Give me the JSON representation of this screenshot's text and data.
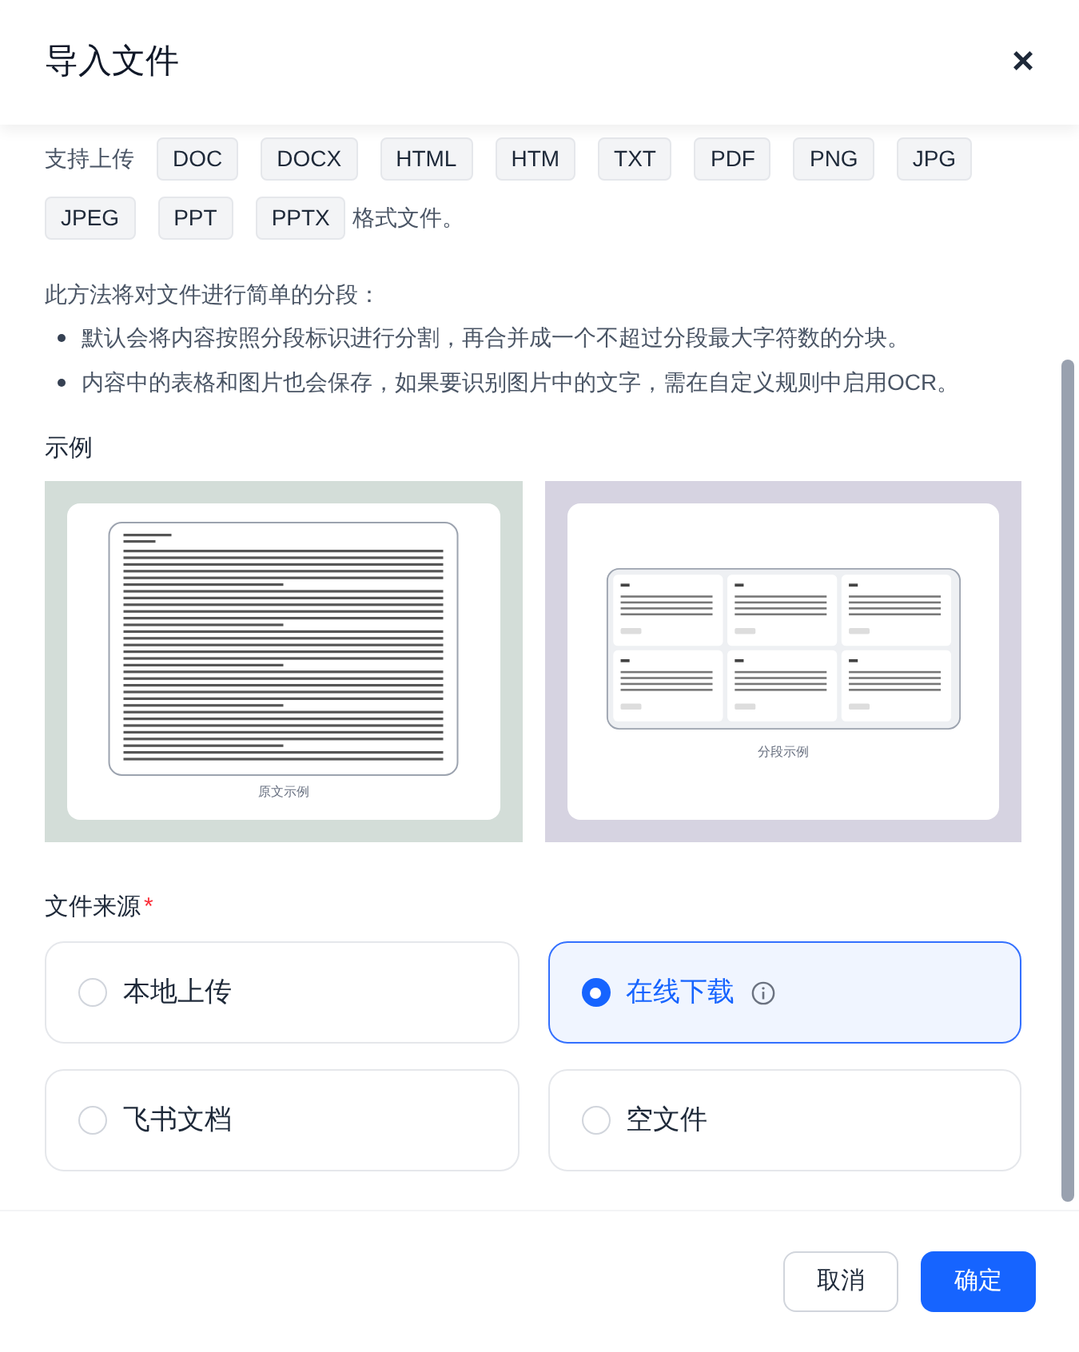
{
  "dialog": {
    "title": "导入文件",
    "close": "×"
  },
  "formats": {
    "prefix": "支持上传",
    "tags": [
      "DOC",
      "DOCX",
      "HTML",
      "HTM",
      "TXT",
      "PDF",
      "PNG",
      "JPG",
      "JPEG",
      "PPT",
      "PPTX"
    ],
    "suffix": "格式文件。"
  },
  "description": {
    "intro": "此方法将对文件进行简单的分段：",
    "bullets": [
      "默认会将内容按照分段标识进行分割，再合并成一个不超过分段最大字符数的分块。",
      "内容中的表格和图片也会保存，如果要识别图片中的文字，需在自定义规则中启用OCR。"
    ]
  },
  "example": {
    "label": "示例",
    "images": [
      {
        "kind": "original",
        "caption": "原文示例",
        "color": "#d3ddd8"
      },
      {
        "kind": "segments",
        "caption": "分段示例",
        "color": "#d6d3e1"
      }
    ]
  },
  "source": {
    "label": "文件来源",
    "required_mark": "*",
    "options": [
      {
        "label": "本地上传",
        "selected": false,
        "info": false
      },
      {
        "label": "在线下载",
        "selected": true,
        "info": true
      },
      {
        "label": "飞书文档",
        "selected": false,
        "info": false
      },
      {
        "label": "空文件",
        "selected": false,
        "info": false
      }
    ]
  },
  "buttons": [
    {
      "label": "取消",
      "kind": "secondary"
    },
    {
      "label": "确定",
      "kind": "primary"
    }
  ]
}
